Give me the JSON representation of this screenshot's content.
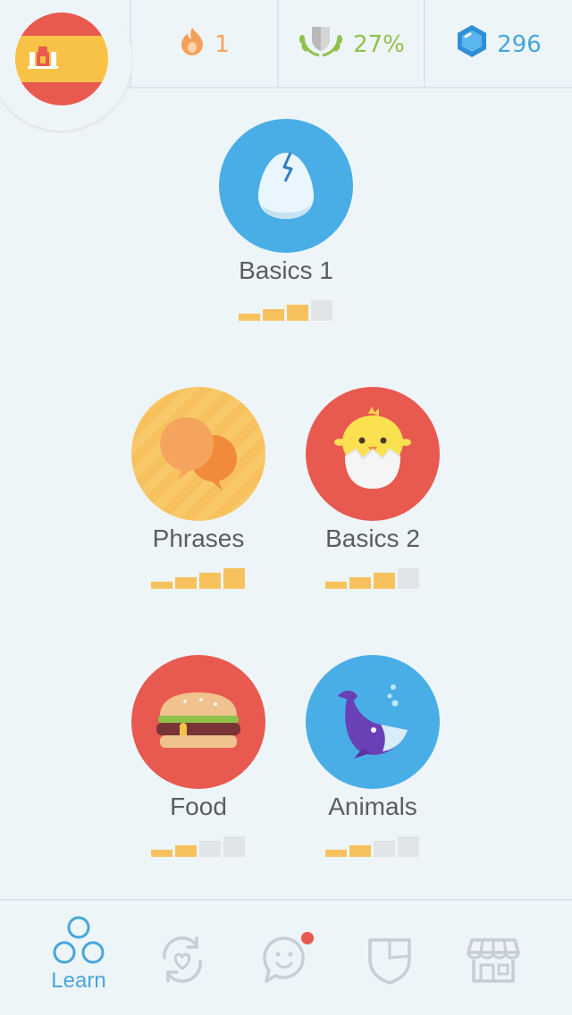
{
  "header": {
    "language_flag": "spain-flag",
    "streak": {
      "icon": "flame-icon",
      "value": "1",
      "color": "#f5a05a"
    },
    "crown_level": {
      "icon": "crown-shield-icon",
      "value": "27%",
      "color": "#8fc24a"
    },
    "gems": {
      "icon": "gem-icon",
      "value": "296",
      "color": "#46a6dc"
    }
  },
  "skills": [
    {
      "name": "Basics 1",
      "icon": "egg-icon",
      "color": "#4aaee6",
      "strength": 3,
      "max_strength": 4
    },
    {
      "name": "Phrases",
      "icon": "speech-bubbles-icon",
      "color": "#f7c25e",
      "strength": 4,
      "max_strength": 4
    },
    {
      "name": "Basics 2",
      "icon": "chick-icon",
      "color": "#e8594f",
      "strength": 3,
      "max_strength": 4
    },
    {
      "name": "Food",
      "icon": "burger-icon",
      "color": "#e8594f",
      "strength": 2,
      "max_strength": 4
    },
    {
      "name": "Animals",
      "icon": "whale-icon",
      "color": "#4aaee6",
      "strength": 2,
      "max_strength": 4
    }
  ],
  "bottom_nav": {
    "items": [
      {
        "label": "Learn",
        "icon": "learn-icon",
        "active": true
      },
      {
        "label": "",
        "icon": "practice-heart-icon",
        "active": false
      },
      {
        "label": "",
        "icon": "chat-face-icon",
        "active": false,
        "notification": true
      },
      {
        "label": "",
        "icon": "shield-icon",
        "active": false
      },
      {
        "label": "",
        "icon": "shop-icon",
        "active": false
      }
    ],
    "active_color": "#46a6dc",
    "inactive_color": "#c7cfd4",
    "notification_color": "#e8594f"
  }
}
